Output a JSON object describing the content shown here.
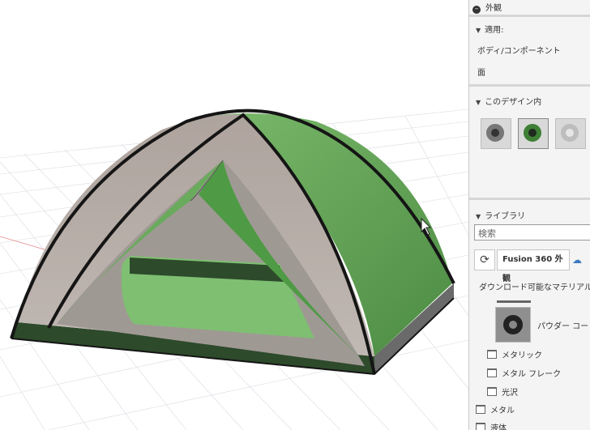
{
  "viewport": {
    "model": "tent"
  },
  "panel": {
    "section_title": "外観",
    "apply_header": "適用:",
    "apply_option_body": "ボディ/コンポーネント",
    "apply_option_face": "面",
    "in_design_header": "このデザイン内",
    "library_header": "ライブラリ",
    "search_placeholder": "検索",
    "library_tab": "Fusion 360 外観",
    "downloadable": "ダウンロード可能なマテリアル",
    "material_item": "パウダー コート",
    "folders": [
      "メタリック",
      "メタル フレーク",
      "光沢"
    ],
    "root_folders": [
      "メタル",
      "液体"
    ]
  },
  "colors": {
    "tent_green": "#5fa052",
    "tent_grey": "#b5aca6",
    "floor_dark": "#2d4a2b"
  }
}
